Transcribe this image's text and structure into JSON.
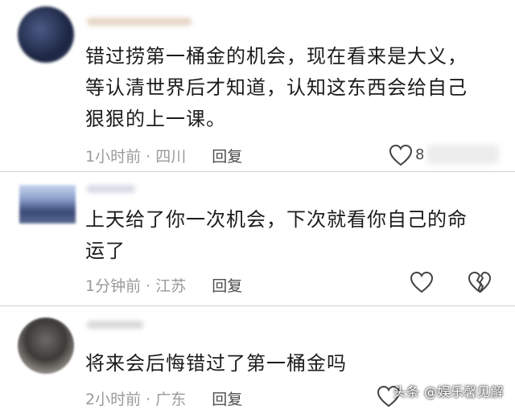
{
  "comments": [
    {
      "text": "错过捞第一桶金的机会，现在看来是大义，\n等认清世界后才知道，认知这东西会给自己\n狠狠的上一课。",
      "time": "1小时前",
      "location": "四川",
      "reply_label": "回复",
      "like_count": "8"
    },
    {
      "text": "上天给了你一次机会，下次就看你自己的命\n运了",
      "time": "1分钟前",
      "location": "江苏",
      "reply_label": "回复"
    },
    {
      "text": "将来会后悔错过了第一桶金吗",
      "time": "2小时前",
      "location": "广东",
      "reply_label": "回复"
    }
  ],
  "meta_separator": "·",
  "watermark": "头条 @娱乐馨见解",
  "icons": {
    "like": "heart-outline-icon",
    "dislike": "broken-heart-icon"
  },
  "colors": {
    "text": "#1c1c1c",
    "meta": "#9a9a9a",
    "reply": "#4d4d4d",
    "divider": "#d0d0d0"
  }
}
